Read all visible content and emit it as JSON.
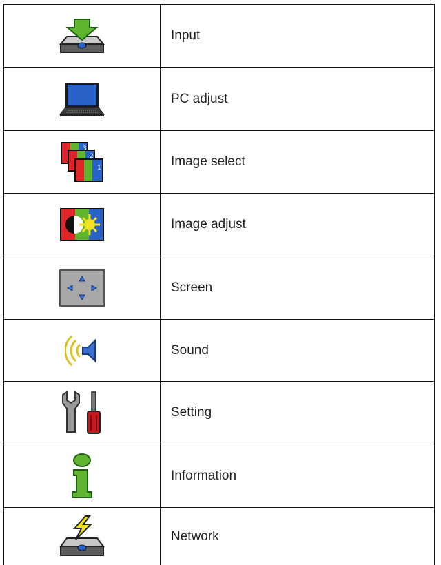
{
  "menu": {
    "items": [
      {
        "label": "Input",
        "icon": "projector-input-icon"
      },
      {
        "label": "PC adjust",
        "icon": "laptop-icon"
      },
      {
        "label": "Image select",
        "icon": "image-select-icon"
      },
      {
        "label": "Image adjust",
        "icon": "image-adjust-icon"
      },
      {
        "label": "Screen",
        "icon": "screen-arrows-icon"
      },
      {
        "label": "Sound",
        "icon": "speaker-icon"
      },
      {
        "label": "Setting",
        "icon": "wrench-screwdriver-icon"
      },
      {
        "label": "Information",
        "icon": "info-icon"
      },
      {
        "label": "Network",
        "icon": "projector-network-icon"
      }
    ]
  },
  "colors": {
    "border": "#111111",
    "text": "#231f20",
    "green": "#5fb52e",
    "blue": "#2a63c8",
    "red": "#e0262b",
    "yellow": "#f4e21e"
  }
}
